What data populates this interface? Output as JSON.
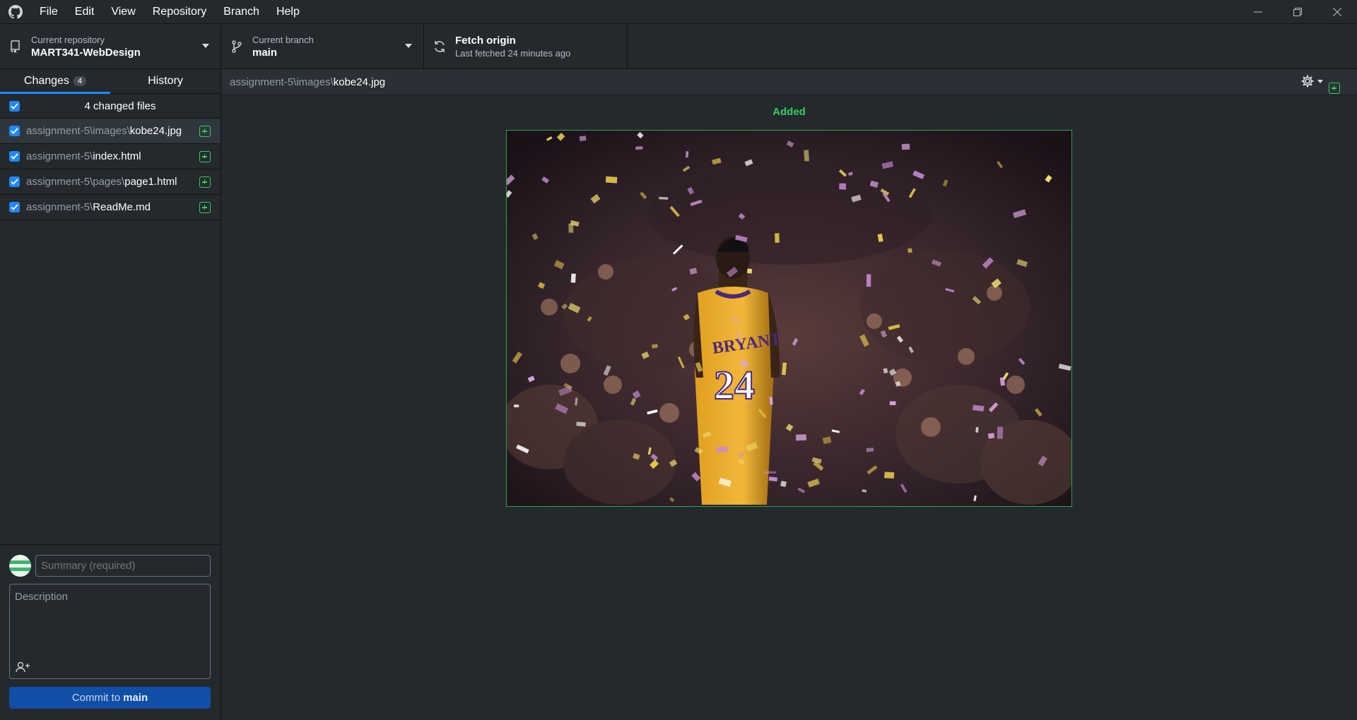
{
  "titlebar": {
    "menu": [
      "File",
      "Edit",
      "View",
      "Repository",
      "Branch",
      "Help"
    ]
  },
  "toolbar": {
    "repo": {
      "label": "Current repository",
      "value": "MART341-WebDesign"
    },
    "branch": {
      "label": "Current branch",
      "value": "main"
    },
    "fetch": {
      "label": "Fetch origin",
      "value": "Last fetched 24 minutes ago"
    }
  },
  "sidebar": {
    "tabs": [
      {
        "label": "Changes",
        "badge": "4"
      },
      {
        "label": "History"
      }
    ],
    "files_header": "4 changed files",
    "files": [
      {
        "dir": "assignment-5\\images\\",
        "name": "kobe24.jpg"
      },
      {
        "dir": "assignment-5\\",
        "name": "index.html"
      },
      {
        "dir": "assignment-5\\pages\\",
        "name": "page1.html"
      },
      {
        "dir": "assignment-5\\",
        "name": "ReadMe.md"
      }
    ]
  },
  "commit": {
    "summary_placeholder": "Summary (required)",
    "description_placeholder": "Description",
    "button_prefix": "Commit to",
    "button_branch": "main"
  },
  "diff": {
    "path_dir": "assignment-5\\images\\",
    "path_name": "kobe24.jpg",
    "status": "Added",
    "image_jersey_name": "BRYANT",
    "image_jersey_number": "24"
  },
  "colors": {
    "accent": "#2188ff",
    "added": "#34d058",
    "commit_button": "#0f4fa8"
  }
}
